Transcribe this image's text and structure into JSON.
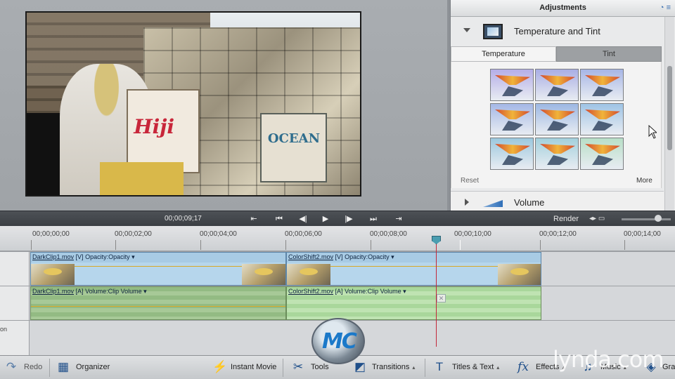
{
  "monitor": {
    "timecode": "00;00;09;17"
  },
  "adjustments": {
    "title": "Adjustments",
    "header_icons": "◔ ≡",
    "effect_name": "Temperature and Tint",
    "tabs": [
      "Temperature",
      "Tint"
    ],
    "active_tab": "Temperature",
    "reset_label": "Reset",
    "more_label": "More",
    "next_effect": "Volume",
    "thumb_tints": [
      "#b5aee8",
      "#a9aee4",
      "#a7b6e6",
      "#a5b8e6",
      "#9db8e3",
      "#9fc4e5",
      "#9cc8de",
      "#a3d0dc",
      "#b8dfc7"
    ]
  },
  "transport": {
    "buttons": [
      "⇤",
      "⏮",
      "◀|",
      "▶",
      "|▶",
      "⏭",
      "⇥"
    ],
    "render_label": "Render",
    "zoom_icons": "◂▸  ▭"
  },
  "timeline": {
    "ruler_labels": [
      "00;00;00;00",
      "00;00;02;00",
      "00;00;04;00",
      "00;00;06;00",
      "00;00;08;00",
      "00;00;10;00",
      "00;00;12;00",
      "00;00;14;00"
    ],
    "gutter_fragment": "on",
    "clips": {
      "video1": {
        "name": "DarkClip1.mov",
        "kind": "[V]",
        "effect": "Opacity:Opacity"
      },
      "video2": {
        "name": "ColorShift2.mov",
        "kind": "[V]",
        "effect": "Opacity:Opacity"
      },
      "audio1": {
        "name": "DarkClip1.mov",
        "kind": "[A]",
        "effect": "Volume:Clip Volume"
      },
      "audio2": {
        "name": "ColorShift2.mov",
        "kind": "[A]",
        "effect": "Volume:Clip Volume"
      }
    },
    "marker_glyph": "✕"
  },
  "taskbar": {
    "redo": "Redo",
    "organizer": "Organizer",
    "instant_movie": "Instant Movie",
    "tools": "Tools",
    "transitions": "Transitions",
    "titles_text": "Titles & Text",
    "effects": "Effects",
    "music": "Music",
    "graphics": "Gra"
  },
  "watermarks": {
    "badge": "MC",
    "lynda": "lynda.com"
  }
}
